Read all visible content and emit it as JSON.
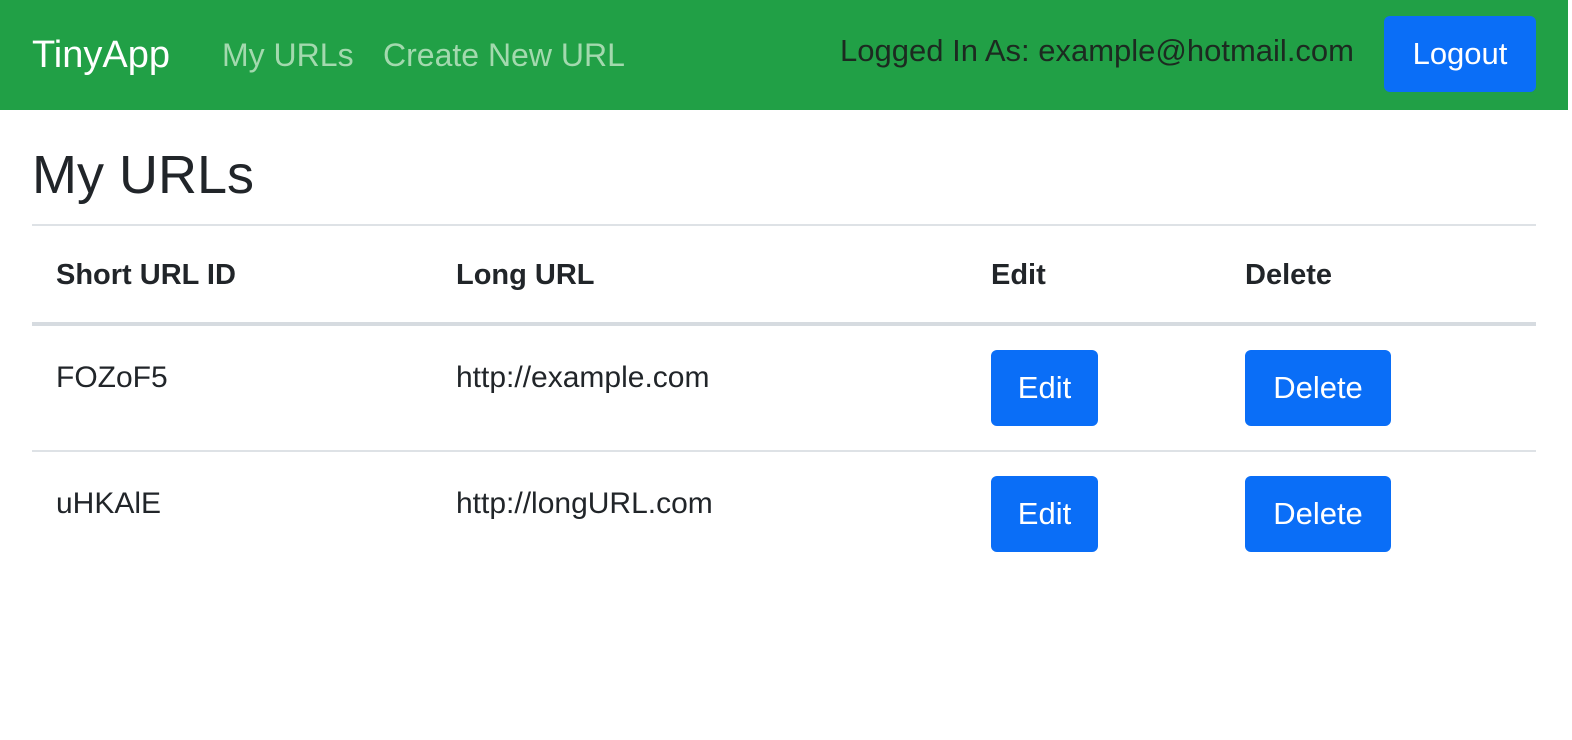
{
  "navbar": {
    "brand": "TinyApp",
    "links": [
      {
        "label": "My URLs"
      },
      {
        "label": "Create New URL"
      }
    ],
    "logged_in_text": "Logged In As: example@hotmail.com",
    "logout_label": "Logout"
  },
  "page": {
    "title": "My URLs"
  },
  "table": {
    "headers": [
      "Short URL ID",
      "Long URL",
      "Edit",
      "Delete"
    ],
    "rows": [
      {
        "short_id": "FOZoF5",
        "long_url": "http://example.com",
        "edit_label": "Edit",
        "delete_label": "Delete"
      },
      {
        "short_id": "uHKAlE",
        "long_url": "http://longURL.com",
        "edit_label": "Edit",
        "delete_label": "Delete"
      }
    ]
  },
  "colors": {
    "navbar": "#21a046",
    "primary_button": "#0a6ef7",
    "text": "#212529"
  }
}
